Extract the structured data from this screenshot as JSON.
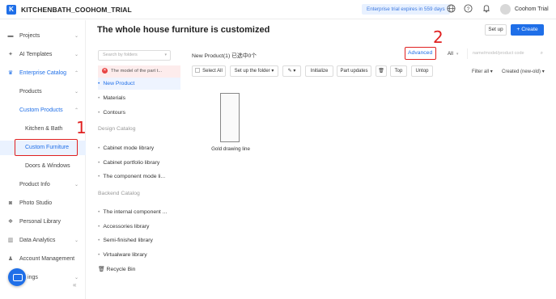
{
  "topbar": {
    "logo_letter": "K",
    "app_name": "KITCHENBATH_COOHOM_TRIAL",
    "expiry": "Enterprise trial expires in 559 days",
    "user_name": "Coohom Trial"
  },
  "sidebar": {
    "items": [
      {
        "label": "Projects"
      },
      {
        "label": "AI Templates"
      },
      {
        "label": "Enterprise Catalog"
      },
      {
        "label": "Products"
      },
      {
        "label": "Custom Products"
      },
      {
        "label": "Kitchen & Bath"
      },
      {
        "label": "Custom Furniture"
      },
      {
        "label": "Doors & Windows"
      },
      {
        "label": "Product Info"
      },
      {
        "label": "Photo Studio"
      },
      {
        "label": "Personal Library"
      },
      {
        "label": "Data Analytics"
      },
      {
        "label": "Account Management"
      },
      {
        "label": "ings"
      }
    ],
    "collapse": "«"
  },
  "annotations": {
    "marker1": "1",
    "marker2": "2"
  },
  "header": {
    "title": "The whole house furniture is customized",
    "setup_label": "Set up",
    "create_label": "+ Create"
  },
  "tree": {
    "search_placeholder": "Search by folders",
    "error_item": "The model of the part t...",
    "new_product": "New Product",
    "materials": "Materials",
    "contours": "Contours",
    "design_catalog": "Design Catalog",
    "cabinet_mode": "Cabinet mode library",
    "cabinet_portfolio": "Cabinet portfolio library",
    "component_mode": "The component mode li...",
    "backend_catalog": "Backend Catalog",
    "internal_component": "The internal component ...",
    "accessories": "Accessories library",
    "semi_finished": "Semi-finished library",
    "virtualware": "Virtualware library",
    "recycle_bin": "Recycle Bin"
  },
  "content": {
    "path_label": "New Product(1)  已选中0个",
    "advanced_label": "Advanced",
    "filter_all": "All",
    "search_placeholder": "name/model/product code",
    "toolbar": {
      "select_all": "Select All",
      "setup_folder": "Set up the folder",
      "initialize": "Initialize",
      "part_updates": "Part updates",
      "top": "Top",
      "untop": "Untop",
      "filter_all": "Filter all",
      "sort": "Created (new-old)"
    },
    "products": [
      {
        "name": "Gold drawing line"
      }
    ]
  }
}
